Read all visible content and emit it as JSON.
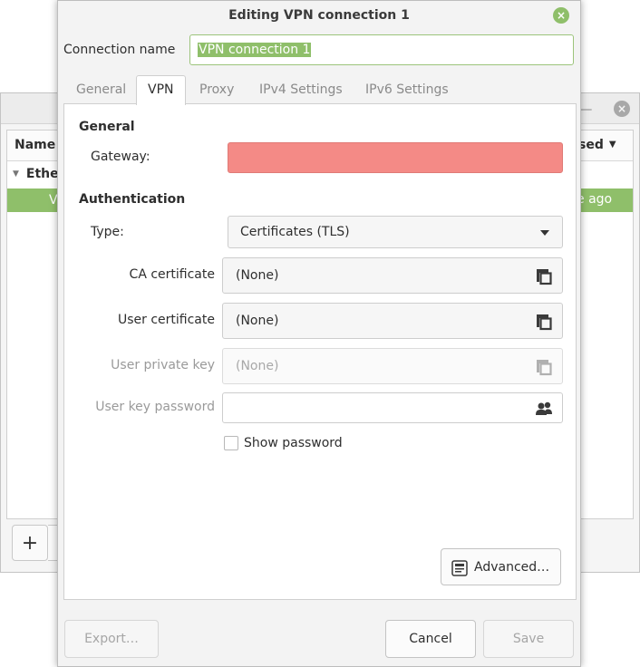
{
  "background_window": {
    "minimize_glyph": "—",
    "close_glyph": "×",
    "column_name": "Name",
    "column_used": "sed",
    "column_used_caret": "▼",
    "group_label": "Ethe",
    "selected_row_left": "V",
    "selected_row_right": "e ago",
    "add_button_label": "+"
  },
  "dialog": {
    "title": "Editing VPN connection 1",
    "close_glyph": "×",
    "connection_name_label": "Connection name",
    "connection_name_value": "VPN connection 1",
    "tabs": [
      {
        "label": "General",
        "active": false
      },
      {
        "label": "VPN",
        "active": true
      },
      {
        "label": "Proxy",
        "active": false
      },
      {
        "label": "IPv4 Settings",
        "active": false
      },
      {
        "label": "IPv6 Settings",
        "active": false
      }
    ],
    "general_section": "General",
    "gateway_label": "Gateway:",
    "gateway_value": "",
    "authentication_section": "Authentication",
    "type_label": "Type:",
    "type_value": "Certificates (TLS)",
    "ca_certificate_label": "CA certificate",
    "ca_certificate_value": "(None)",
    "user_certificate_label": "User certificate",
    "user_certificate_value": "(None)",
    "user_private_key_label": "User private key",
    "user_private_key_value": "(None)",
    "user_key_password_label": "User key password",
    "user_key_password_value": "",
    "show_password_label": "Show password",
    "advanced_button": "Advanced…",
    "export_button": "Export…",
    "cancel_button": "Cancel",
    "save_button": "Save"
  },
  "colors": {
    "accent": "#8fbf6a",
    "error_field": "#f48a86"
  }
}
